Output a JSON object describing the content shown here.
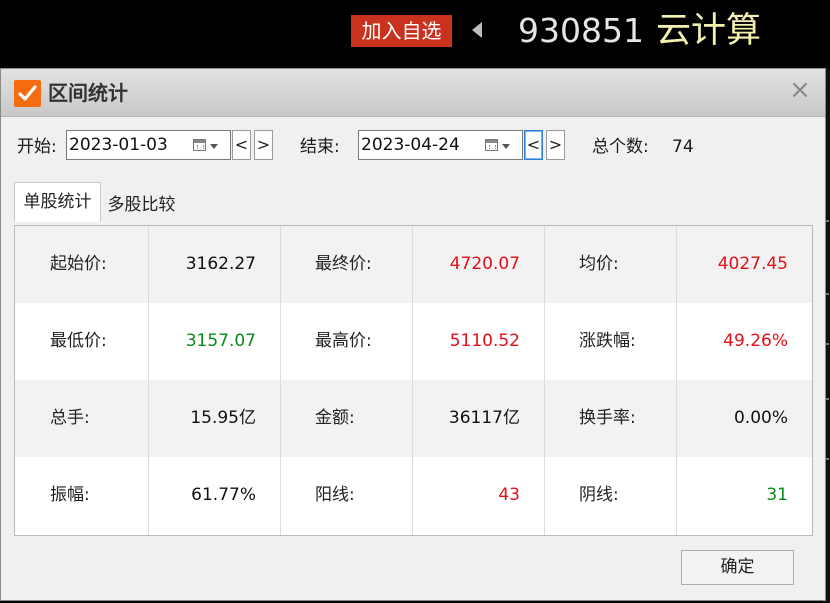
{
  "header": {
    "add_watchlist_label": "加入自选",
    "stock_code": "930851",
    "stock_name": "云计算"
  },
  "dialog": {
    "title": "区间统计",
    "start_label": "开始:",
    "start_date": "2023-01-03",
    "end_label": "结束:",
    "end_date": "2023-04-24",
    "prev_label": "<",
    "next_label": ">",
    "count_label": "总个数:",
    "count_value": "74",
    "tabs": [
      {
        "label": "单股统计",
        "active": true
      },
      {
        "label": "多股比较",
        "active": false
      }
    ],
    "stats": [
      [
        {
          "key": "起始价:",
          "value": "3162.27",
          "tone": "black"
        },
        {
          "key": "最终价:",
          "value": "4720.07",
          "tone": "red"
        },
        {
          "key": "均价:",
          "value": "4027.45",
          "tone": "red"
        }
      ],
      [
        {
          "key": "最低价:",
          "value": "3157.07",
          "tone": "green"
        },
        {
          "key": "最高价:",
          "value": "5110.52",
          "tone": "red"
        },
        {
          "key": "涨跌幅:",
          "value": "49.26%",
          "tone": "red"
        }
      ],
      [
        {
          "key": "总手:",
          "value": "15.95亿",
          "tone": "black"
        },
        {
          "key": "金额:",
          "value": "36117亿",
          "tone": "black"
        },
        {
          "key": "换手率:",
          "value": "0.00%",
          "tone": "black"
        }
      ],
      [
        {
          "key": "振幅:",
          "value": "61.77%",
          "tone": "black"
        },
        {
          "key": "阳线:",
          "value": "43",
          "tone": "red"
        },
        {
          "key": "阴线:",
          "value": "31",
          "tone": "green"
        }
      ]
    ],
    "ok_label": "确定"
  },
  "colors": {
    "up": "#e0101a",
    "down": "#0a8a18",
    "accent": "#f46b10",
    "add_button": "#c8321e"
  }
}
